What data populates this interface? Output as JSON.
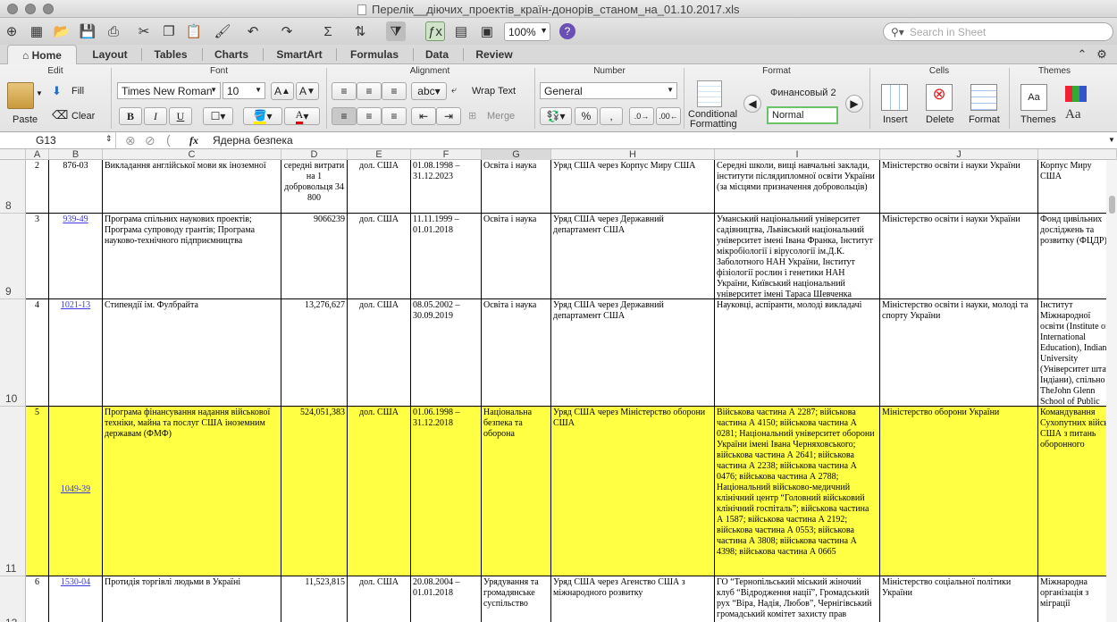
{
  "window": {
    "title": "Перелік__діючих_проектів_країн-донорів_станом_на_01.10.2017.xls"
  },
  "toolbar": {
    "zoom": "100%",
    "search_placeholder": "Search in Sheet"
  },
  "ribbon_tabs": [
    {
      "label": "Home",
      "active": true
    },
    {
      "label": "Layout"
    },
    {
      "label": "Tables"
    },
    {
      "label": "Charts"
    },
    {
      "label": "SmartArt"
    },
    {
      "label": "Formulas"
    },
    {
      "label": "Data"
    },
    {
      "label": "Review"
    }
  ],
  "ribbon": {
    "groups": [
      "Edit",
      "Font",
      "Alignment",
      "Number",
      "Format",
      "Cells",
      "Themes"
    ],
    "paste": "Paste",
    "fill": "Fill",
    "clear": "Clear",
    "font_name": "Times New Roman",
    "font_size": "10",
    "bold": "B",
    "italic": "I",
    "underline": "U",
    "wrap_text": "Wrap Text",
    "merge": "Merge",
    "abc": "abc",
    "number_format": "General",
    "conditional": "Conditional",
    "formatting": "Formatting",
    "style_1": "Финансовый 2",
    "style_2": "Normal",
    "insert": "Insert",
    "delete": "Delete",
    "format": "Format",
    "themes": "Themes",
    "aa": "Aa"
  },
  "formula_bar": {
    "cell_ref": "G13",
    "fx": "fx",
    "content": "Ядерна безпека"
  },
  "columns": [
    "A",
    "B",
    "C",
    "D",
    "E",
    "F",
    "G",
    "H",
    "I",
    "J",
    ""
  ],
  "rows": [
    {
      "num": "8",
      "cells": {
        "A": "2",
        "B": "876-03",
        "C": "Викладання англійської мови як іноземної",
        "D": "середні витрати на 1 добровольця 34 800",
        "E": "дол. США",
        "F": "01.08.1998 – 31.12.2023",
        "G": "Освіта і наука",
        "H": "Уряд США через Корпус Миру США",
        "I": "Середні школи, вищі навчальні заклади, інститути післядипломної освіти України (за місцями призначення добровольців)",
        "J": "Міністерство освіти і науки України",
        "K": "Корпус Миру США"
      }
    },
    {
      "num": "9",
      "cells": {
        "A": "3",
        "B": "939-49",
        "C": "Програма спільних наукових проектів; Програма супроводу грантів; Програма науково-технічного підприємництва",
        "D": "9066239",
        "E": "дол. США",
        "F": "11.11.1999 – 01.01.2018",
        "G": "Освіта і наука",
        "H": "Уряд США через Державний департамент США",
        "I": "Уманський національний університет садівництва, Львівський національний університет імені Івана Франка, Інститут мікробіології і вірусології ім.Д.К. Заболотного НАН України, Інститут фізіології рослин і генетики НАН України, Київський національний університет імені Тараса Шевченка",
        "J": "Міністерство освіти і науки України",
        "K": "Фонд цивільних досліджень та розвитку (ФЦДР)"
      }
    },
    {
      "num": "10",
      "cells": {
        "A": "4",
        "B": "1021-13",
        "C": "Стипендії ім. Фулбрайта",
        "D": "13,276,627",
        "E": "дол. США",
        "F": "08.05.2002 – 30.09.2019",
        "G": "Освіта і наука",
        "H": "Уряд США через Державний департамент США",
        "I": "Науковці, аспіранти, молоді викладачі",
        "J": "Міністерство освіти і науки, молоді та спорту України",
        "K": "Інститут Міжнародної освіти (Institute of International Education), Indiana University (Університет штату Індіани), спільно з TheJohn Glenn School of Public Affairs of theOhio State University(Інститут державного врядування ім.Джона Гленна Університету штату Огайо)"
      }
    },
    {
      "num": "11",
      "highlight": true,
      "cells": {
        "A": "5",
        "B": "1049-39",
        "C": "Програма фінансування надання військової техніки, майна та послуг США іноземним деpжавам (ФМФ)",
        "D": "524,051,383",
        "E": "дол. США",
        "F": "01.06.1998 – 31.12.2018",
        "G": "Національна безпека та оборона",
        "H": "Уряд США через Міністерство оборони США",
        "I": "Військова частина А 2287; військова частина А 4150; військова частина А 0281; Національний університет оборони України імені Івана Черняховського; військова частина А 2641; військова частина А 2238; військова частина А 0476; військова частина А 2788; Національний військово-медичний клінічний центр “Головний військовий клінічний госпіталь”; військова частина А 1587; військова частина А 2192; військова частина А 0553; військова частина А 3808; військова частина А 4398; військова частина А 0665",
        "J": "Міністерство оборони України",
        "K": "Командування Сухопутних військ США з питань оборонного"
      }
    },
    {
      "num": "12",
      "cells": {
        "A": "6",
        "B": "1530-04",
        "C": "Протидія торгівлі людьми в Україні",
        "D": "11,523,815",
        "E": "дол. США",
        "F": "20.08.2004 – 01.01.2018",
        "G": "Урядування та громадянське суспільство",
        "H": "Уряд США через Агенство США з міжнародного розвитку",
        "I": "ГО “Тернопільський міський жіночий клуб “Відродження нації”, Громадський рух “Віра, Надія, Любов”, Чернігівський громадський комітет захисту прав людини",
        "J": "Міністерство соціальної політики України",
        "K": "Міжнародна організація з міграції"
      }
    }
  ]
}
